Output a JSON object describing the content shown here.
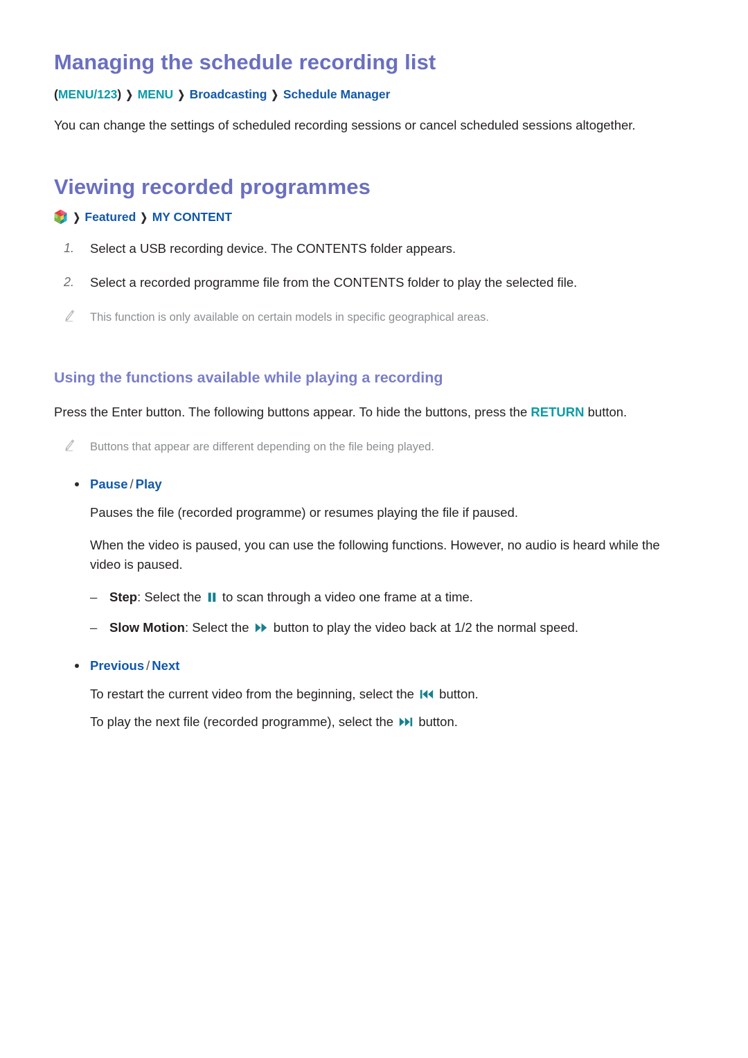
{
  "document": {
    "section1": {
      "heading": "Managing the schedule recording list",
      "breadcrumb": {
        "open_paren": "(",
        "item1": "MENU/123",
        "close_paren": ")",
        "sep": "❯",
        "item2": "MENU",
        "item3": "Broadcasting",
        "item4": "Schedule Manager"
      },
      "paragraph": "You can change the settings of scheduled recording sessions or cancel scheduled sessions altogether."
    },
    "section2": {
      "heading": "Viewing recorded programmes",
      "breadcrumb": {
        "hub_icon": "smart-hub-icon",
        "sep": "❯",
        "item1": "Featured",
        "item2": "MY CONTENT"
      },
      "steps": [
        {
          "num": "1.",
          "text": "Select a USB recording device. The CONTENTS folder appears."
        },
        {
          "num": "2.",
          "text": "Select a recorded programme file from the CONTENTS folder to play the selected file."
        }
      ],
      "note": "This function is only available on certain models in specific geographical areas."
    },
    "section3": {
      "heading": "Using the functions available while playing a recording",
      "intro_part1": "Press the Enter button. The following buttons appear. To hide the buttons, press the ",
      "intro_keyword": "RETURN",
      "intro_part2": " button.",
      "note": "Buttons that appear are different depending on the file being played.",
      "bullets": [
        {
          "label1": "Pause",
          "slash": "/",
          "label2": "Play",
          "paragraphs": [
            "Pauses the file (recorded programme) or resumes playing the file if paused.",
            "When the video is paused, you can use the following functions. However, no audio is heard while the video is paused."
          ],
          "subitems": [
            {
              "dash": "–",
              "term": "Step",
              "text_before": ": Select the ",
              "icon": "pause-icon",
              "text_after": " to scan through a video one frame at a time."
            },
            {
              "dash": "–",
              "term": "Slow Motion",
              "text_before": ": Select the ",
              "icon": "fast-forward-icon",
              "text_after": " button to play the video back at 1/2 the normal speed."
            }
          ]
        },
        {
          "label1": "Previous",
          "slash": "/",
          "label2": "Next",
          "lines": [
            {
              "text_before": "To restart the current video from the beginning, select the ",
              "icon": "skip-previous-icon",
              "text_after": " button."
            },
            {
              "text_before": "To play the next file (recorded programme), select the ",
              "icon": "skip-next-icon",
              "text_after": " button."
            }
          ]
        }
      ]
    }
  },
  "colors": {
    "heading_purple": "#6a6fc0",
    "link_blue": "#1258a8",
    "accent_teal": "#0d9ba8",
    "note_gray": "#8a8d90",
    "body_black": "#231f20"
  }
}
